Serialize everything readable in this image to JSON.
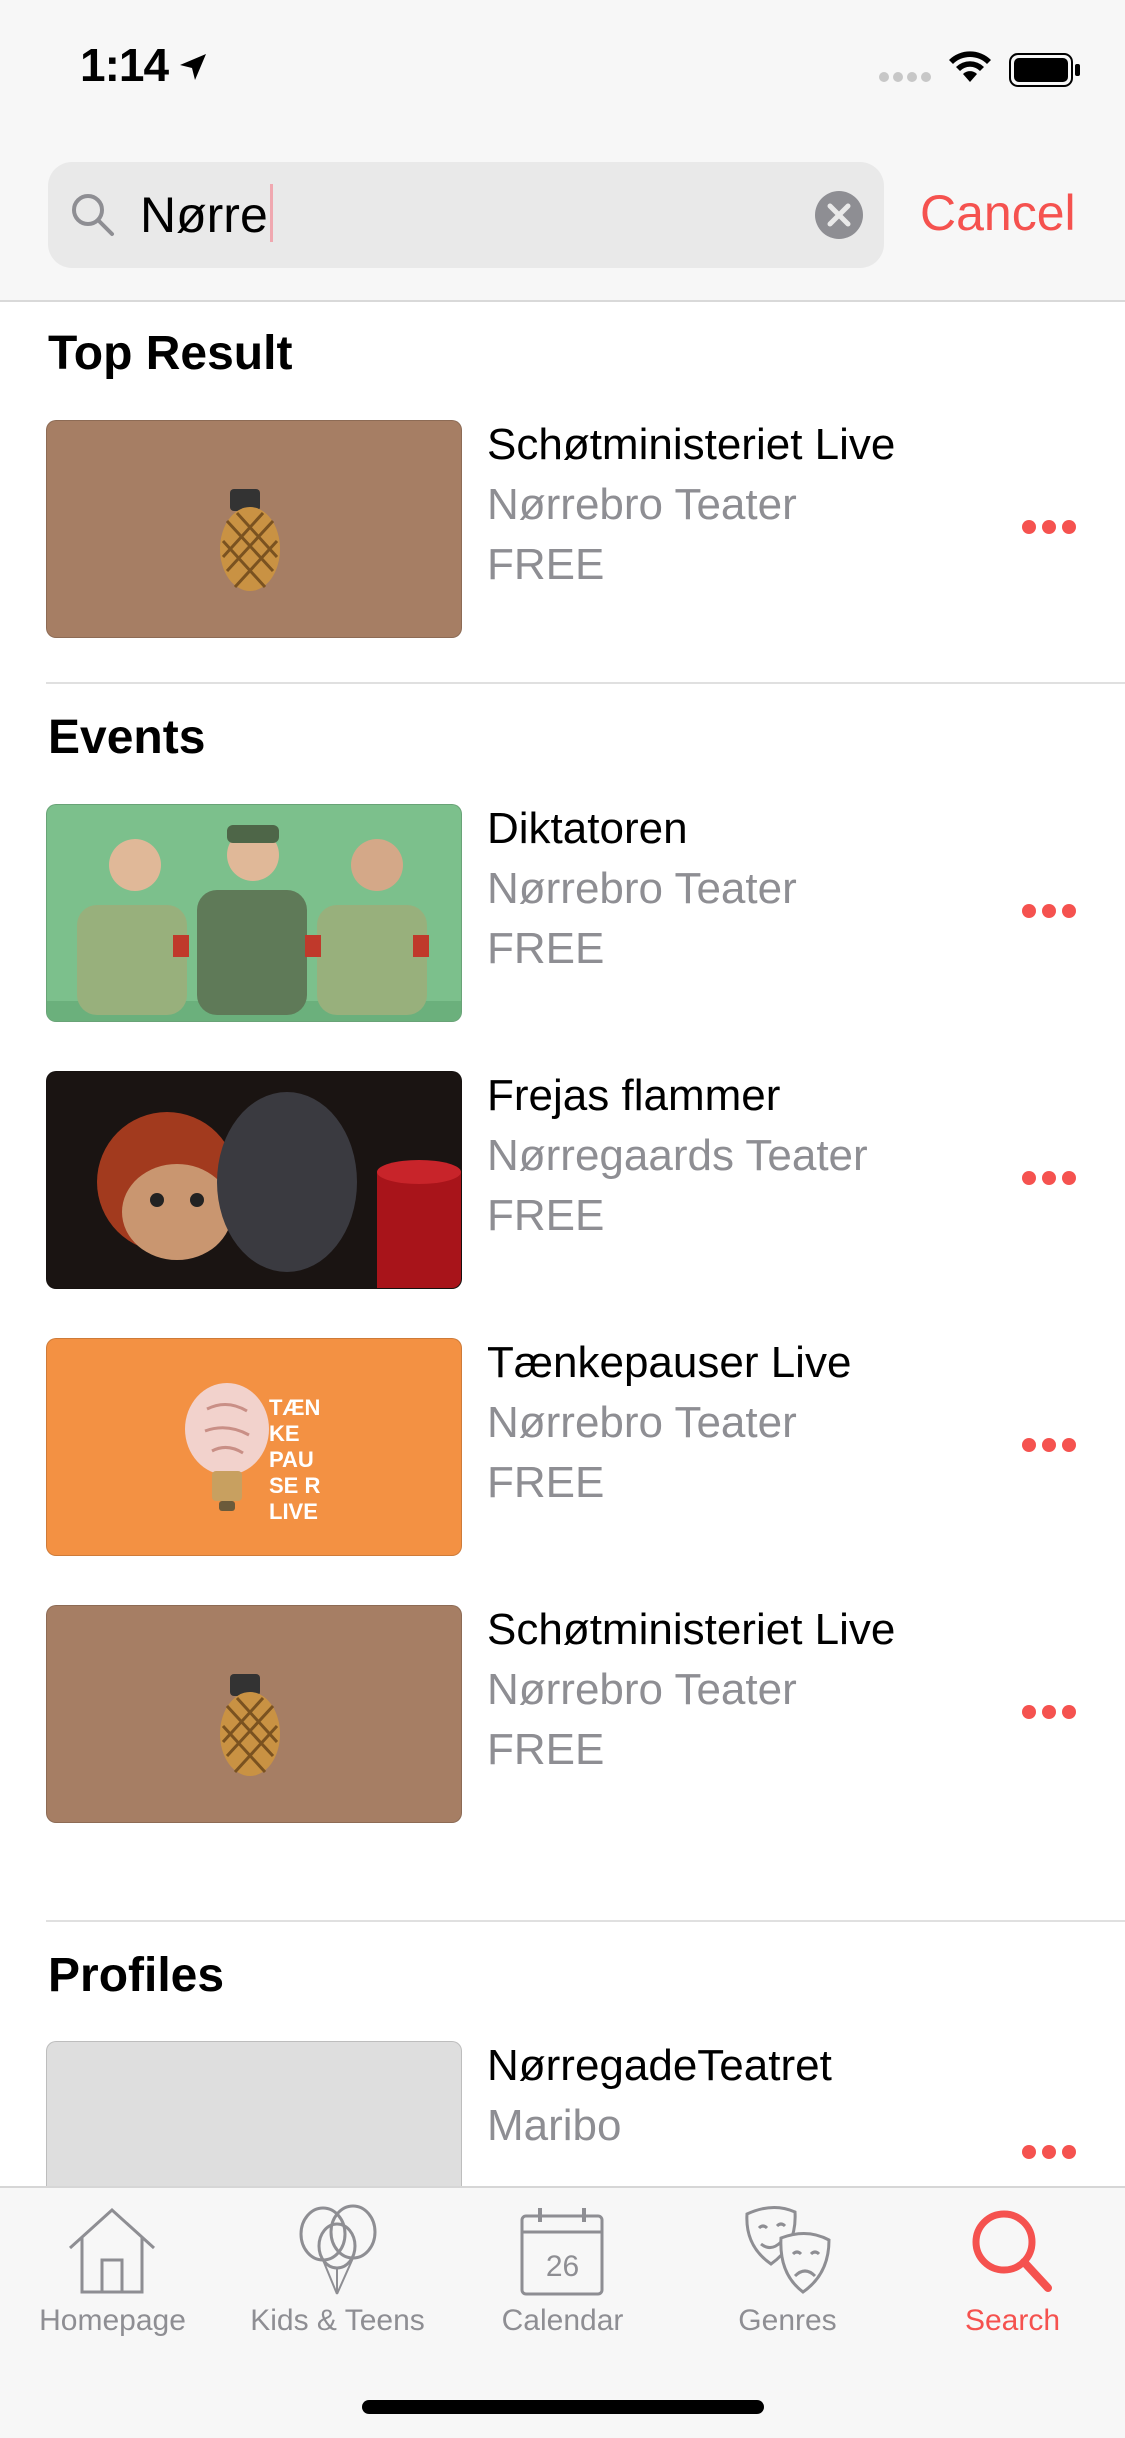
{
  "status": {
    "time": "1:14"
  },
  "search": {
    "query": "Nørre",
    "cancel_label": "Cancel"
  },
  "top_result": {
    "title": "Top Result",
    "item": {
      "title": "Schøtministeriet Live",
      "venue": "Nørrebro Teater",
      "price": "FREE"
    }
  },
  "events": {
    "title": "Events",
    "items": [
      {
        "title": "Diktatoren",
        "venue": "Nørrebro Teater",
        "price": "FREE"
      },
      {
        "title": "Frejas flammer",
        "venue": "Nørregaards Teater",
        "price": "FREE"
      },
      {
        "title": "Tænkepauser Live",
        "venue": "Nørrebro Teater",
        "price": "FREE"
      },
      {
        "title": "Schøtministeriet Live",
        "venue": "Nørrebro Teater",
        "price": "FREE"
      }
    ]
  },
  "profiles": {
    "title": "Profiles",
    "items": [
      {
        "title": "NørregadeTeatret",
        "location": "Maribo"
      }
    ]
  },
  "poster_text": {
    "tankepauser": "TÆN KE PAU SE R LIVE"
  },
  "tabs": [
    {
      "label": "Homepage",
      "icon": "house-icon"
    },
    {
      "label": "Kids & Teens",
      "icon": "balloons-icon"
    },
    {
      "label": "Calendar",
      "icon": "calendar-icon",
      "day": "26"
    },
    {
      "label": "Genres",
      "icon": "theater-masks-icon"
    },
    {
      "label": "Search",
      "icon": "search-icon",
      "active": true
    }
  ],
  "colors": {
    "accent": "#f5524f",
    "secondary_text": "#8e8e93"
  }
}
